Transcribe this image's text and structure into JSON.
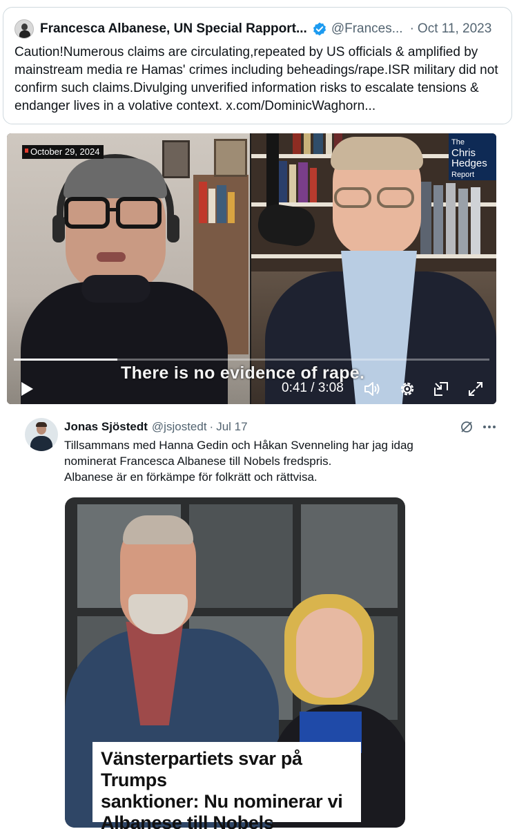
{
  "tweet1": {
    "author_name": "Francesca Albanese, UN Special Rapport...",
    "handle": "@Frances...",
    "separator": "·",
    "date": "Oct 11, 2023",
    "text": "Caution!Numerous claims are circulating,repeated by US officials & amplified by mainstream media re Hamas' crimes including beheadings/rape.ISR military did not confirm such claims.Divulging unverified information risks to escalate tensions & endanger lives in a volative context. x.com/DominicWaghorn..."
  },
  "video": {
    "date_badge": "October 29, 2024",
    "report_logo_line1": "The",
    "report_logo_line2": "Chris",
    "report_logo_line3": "Hedges",
    "report_logo_line4": "Report",
    "subtitle": "There is no evidence of rape.",
    "time": "0:41 / 3:08",
    "progress": 0.218,
    "icons": [
      "play-icon",
      "volume-icon",
      "settings-gear-icon",
      "picture-in-picture-icon",
      "fullscreen-icon"
    ]
  },
  "tweet2": {
    "author_name": "Jonas Sjöstedt",
    "handle": "@jsjostedt",
    "separator": "·",
    "date": "Jul 17",
    "text_lines": [
      "Tillsammans med Hanna Gedin och Håkan Svenneling har jag idag",
      "nominerat Francesca Albanese till Nobels fredspris.",
      "Albanese är en förkämpe för folkrätt och rättvisa."
    ],
    "headline_lines": [
      "Vänsterpartiets svar på Trumps",
      "sanktioner: Nu nominerar vi",
      "Albanese till Nobels fredspris"
    ]
  },
  "colors": {
    "text_primary": "#0f1419",
    "text_secondary": "#536471",
    "border": "#cfd9de",
    "verified_blue": "#1d9bf0"
  }
}
